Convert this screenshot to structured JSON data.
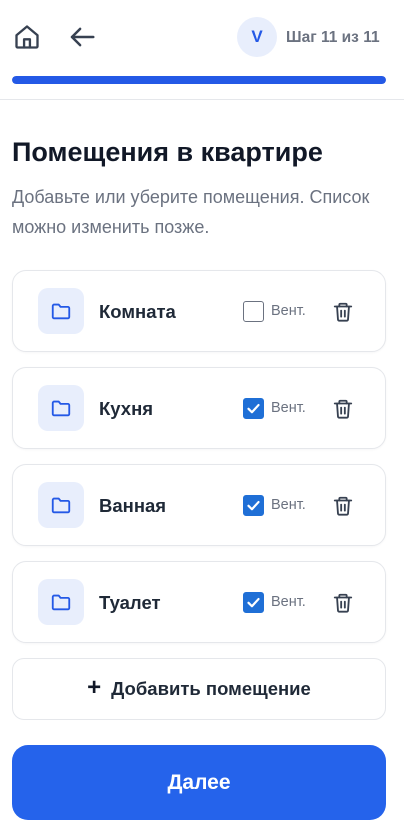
{
  "header": {
    "avatar_initial": "V",
    "step_text": "Шаг 11 из 11",
    "progress": 1.0,
    "icons": {
      "home": "home-icon",
      "back": "arrow-left-icon"
    }
  },
  "page": {
    "title": "Помещения в квартире",
    "subtitle": "Добавьте или уберите помещения. Список можно изменить позже."
  },
  "rooms": [
    {
      "name": "Комната",
      "vent_checked": false,
      "vent_label": "Вент."
    },
    {
      "name": "Кухня",
      "vent_checked": true,
      "vent_label": "Вент."
    },
    {
      "name": "Ванная",
      "vent_checked": true,
      "vent_label": "Вент."
    },
    {
      "name": "Туалет",
      "vent_checked": true,
      "vent_label": "Вент."
    }
  ],
  "add_room": {
    "plus": "+",
    "label": "Добавить помещение"
  },
  "next_button": {
    "label": "Далее"
  },
  "colors": {
    "accent": "#2563eb",
    "checkbox": "#1f6fd6",
    "icon_bg": "#e8eefc",
    "muted_text": "#6b7280"
  }
}
